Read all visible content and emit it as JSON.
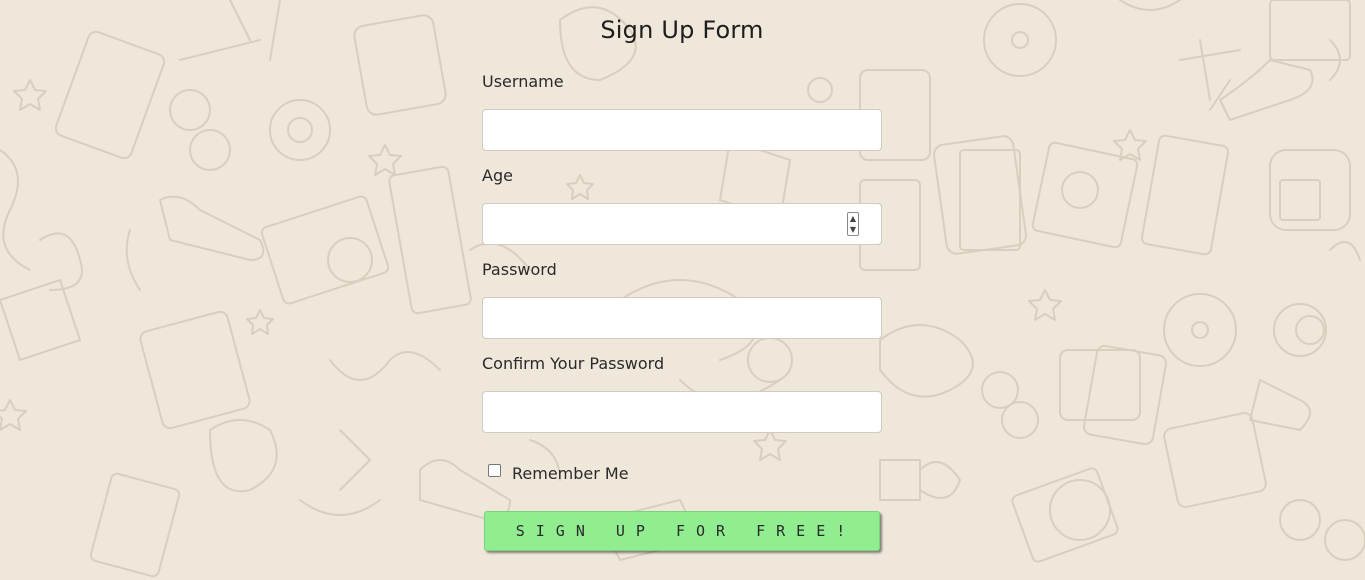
{
  "form": {
    "title": "Sign Up Form",
    "fields": [
      {
        "label": "Username",
        "value": "",
        "type": "text"
      },
      {
        "label": "Age",
        "value": "",
        "type": "number"
      },
      {
        "label": "Password",
        "value": "",
        "type": "password"
      },
      {
        "label": "Confirm Your Password",
        "value": "",
        "type": "password"
      }
    ],
    "remember": {
      "label": "Remember Me",
      "checked": false
    },
    "submit_label": "SIGN UP FOR FREE!"
  },
  "colors": {
    "background": "#efe7da",
    "doodle": "#dcd2c2",
    "button": "#90ee90",
    "input_border": "#cfcac2"
  }
}
